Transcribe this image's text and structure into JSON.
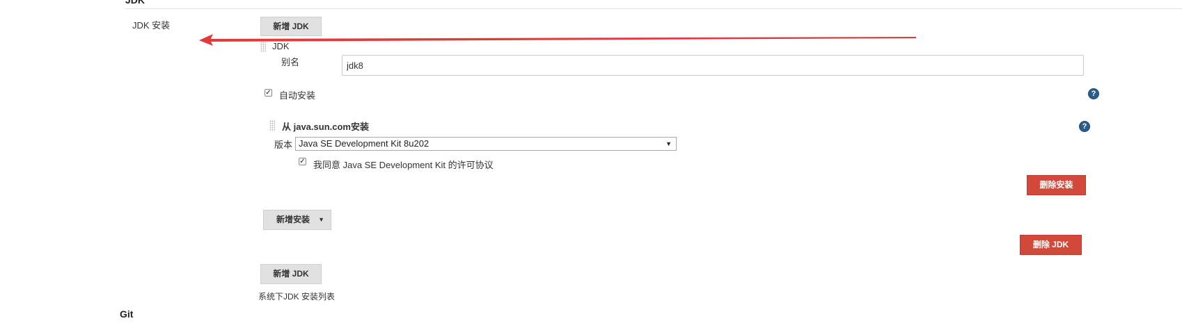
{
  "section": {
    "title": "JDK"
  },
  "jdk_installations": {
    "label": "JDK 安装",
    "add_jdk_button_top": "新增 JDK",
    "entry": {
      "header": "JDK",
      "alias_label": "别名",
      "alias_value": "jdk8",
      "auto_install_label": "自动安装",
      "auto_install_checked": true,
      "installer": {
        "title": "从 java.sun.com安装",
        "version_label": "版本",
        "version_selected": "Java SE Development Kit 8u202",
        "license_label": "我同意 Java SE Development Kit 的许可协议",
        "license_checked": true,
        "delete_installer_button": "删除安装"
      },
      "add_installer_button": "新增安装",
      "delete_jdk_button": "删除 JDK"
    },
    "add_jdk_button_bottom": "新增 JDK",
    "description": "系统下JDK 安装列表"
  },
  "next_section": {
    "title": "Git"
  },
  "colors": {
    "annotation_arrow": "#e23a3a",
    "danger_button": "#d24939",
    "help_icon": "#2b5d8c"
  },
  "icons": {
    "help": "help-icon",
    "drag_handle": "drag-handle-icon",
    "dropdown_caret": "caret-down-icon",
    "checkbox_tick": "check-icon"
  }
}
